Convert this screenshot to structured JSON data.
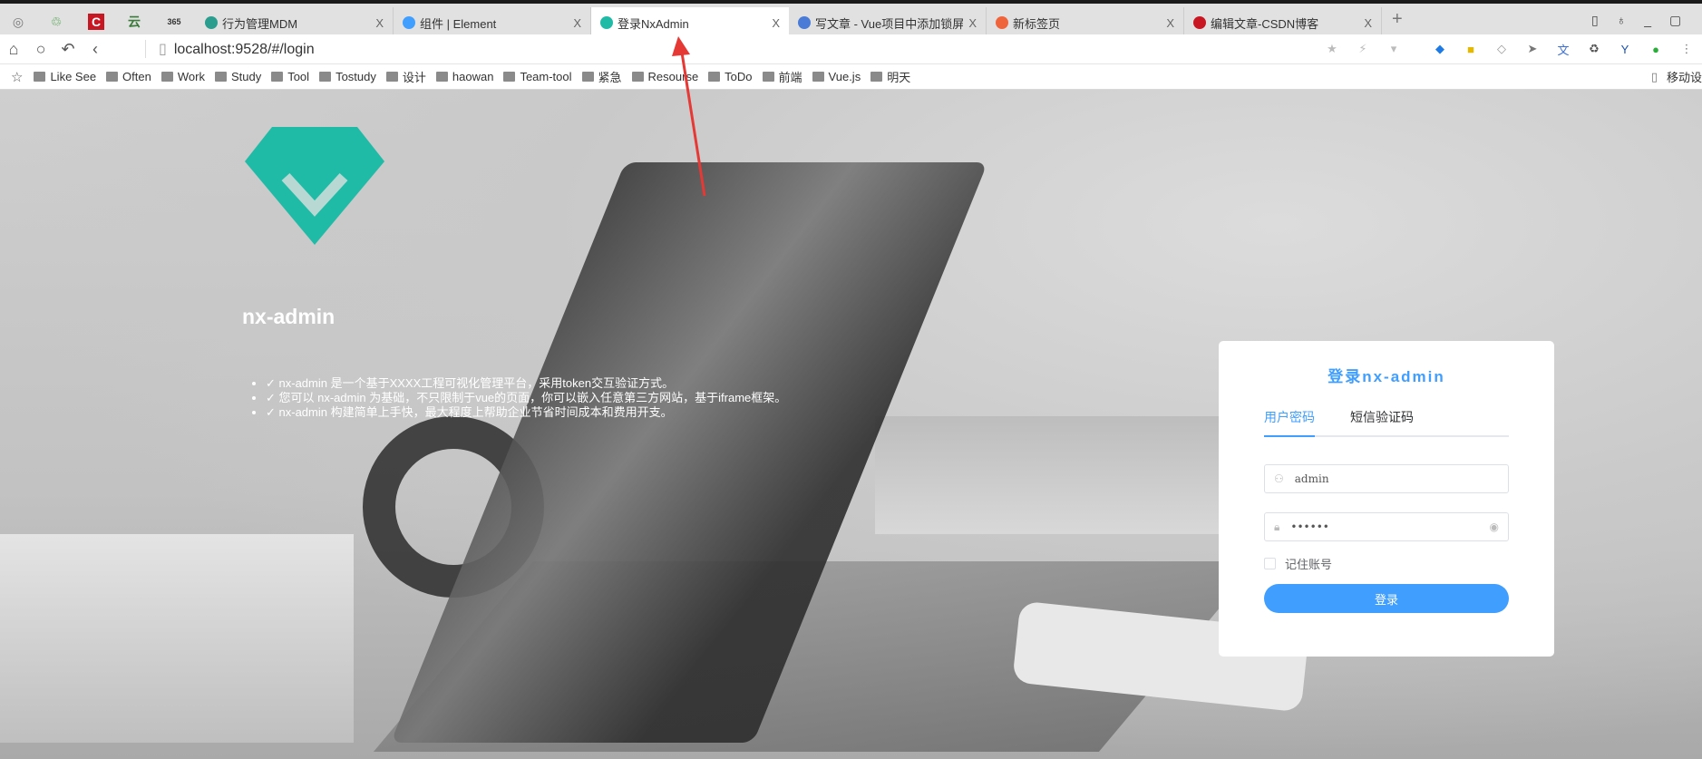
{
  "browser": {
    "tabs": [
      {
        "title": "行为管理MDM",
        "icon": "globe-icon",
        "color": "#2a9d8f"
      },
      {
        "title": "组件 | Element",
        "icon": "element-icon",
        "color": "#409eff"
      },
      {
        "title": "登录NxAdmin",
        "icon": "nx-diamond-icon",
        "color": "#1fbba6",
        "active": true
      },
      {
        "title": "写文章 - Vue项目中添加锁屏",
        "icon": "csdn-write-icon",
        "color": "#4a7bd6"
      },
      {
        "title": "新标签页",
        "icon": "infinity-icon",
        "color": "#f0643c"
      },
      {
        "title": "编辑文章-CSDN博客",
        "icon": "csdn-icon",
        "color": "#c81623"
      }
    ],
    "new_tab": "+",
    "close": "X",
    "url": "localhost:9528/#/login",
    "bookmarks": [
      "Like See",
      "Often",
      "Work",
      "Study",
      "Tool",
      "Tostudy",
      "设计",
      "haowan",
      "Team-tool",
      "紧急",
      "Resourse",
      "ToDo",
      "前端",
      "Vue.js",
      "明天"
    ],
    "mobile_label": "移动设"
  },
  "page": {
    "brand": "nx-admin",
    "features": [
      "✓ nx-admin 是一个基于XXXX工程可视化管理平台，采用token交互验证方式。",
      "✓ 您可以 nx-admin 为基础，不只限制于vue的页面，你可以嵌入任意第三方网站，基于iframe框架。",
      "✓ nx-admin 构建简单上手快，最大程度上帮助企业节省时间成本和费用开支。"
    ],
    "logo_color": "#1fbba6"
  },
  "login": {
    "title": "登录nx-admin",
    "tabs": [
      "用户密码",
      "短信验证码"
    ],
    "username": "admin",
    "password": "••••••",
    "remember": "记住账号",
    "submit": "登录",
    "accent": "#409eff"
  }
}
